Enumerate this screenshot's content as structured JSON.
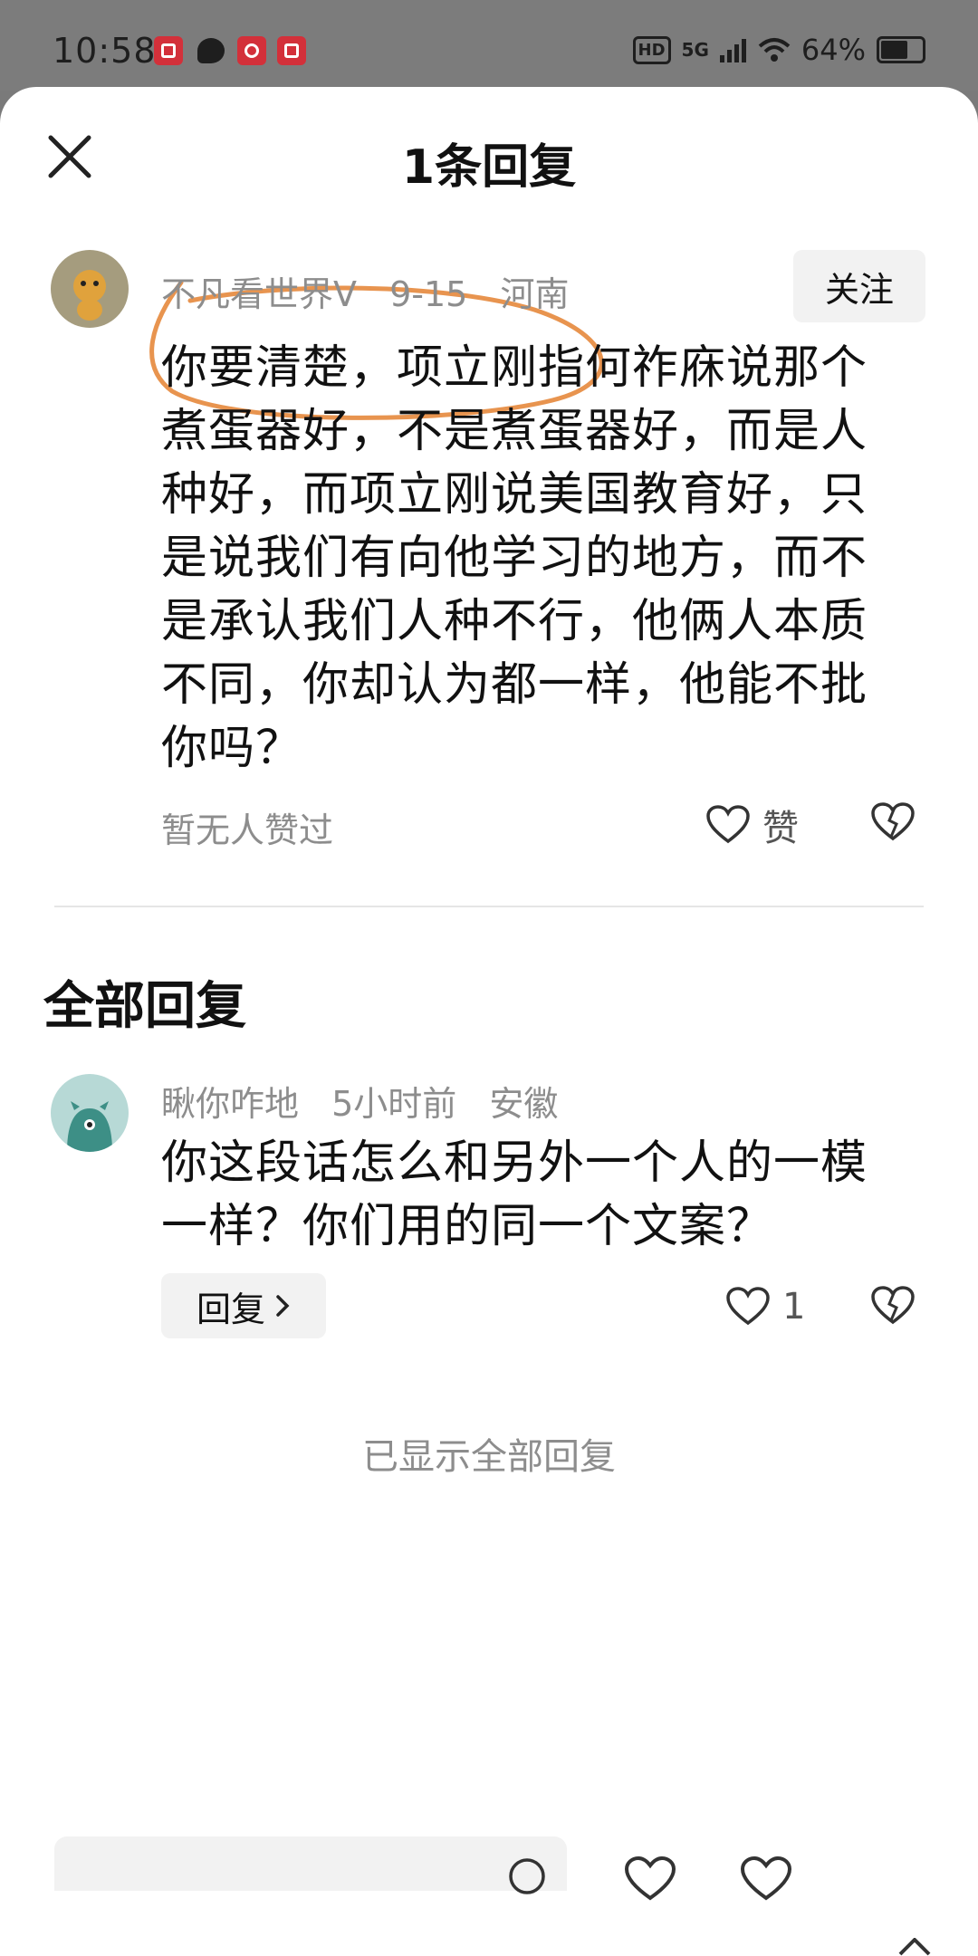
{
  "status_bar": {
    "time": "10:58",
    "network": "5G",
    "hd": "HD",
    "battery": "64%"
  },
  "header": {
    "title": "1条回复"
  },
  "main_comment": {
    "username": "不凡看世界V",
    "date": "9-15",
    "location": "河南",
    "follow_label": "关注",
    "lines": [
      "你要清楚，项立刚指何祚庥说那个",
      "煮蛋器好，不是煮蛋器好，而是人",
      "种好，而项立刚说美国教育好，只",
      "是说我们有向他学习的地方，而不",
      "是承认我们人种不行，他俩人本质",
      "不同，你却认为都一样，他能不批",
      "你吗？"
    ],
    "no_likes": "暂无人赞过",
    "like_label": "赞"
  },
  "replies_section": {
    "title": "全部回复"
  },
  "reply": {
    "username": "瞅你咋地",
    "time": "5小时前",
    "location": "安徽",
    "lines": [
      "你这段话怎么和另外一个人的一模",
      "一样？你们用的同一个文案？"
    ],
    "reply_button": "回复",
    "like_count": "1"
  },
  "footer": {
    "all_shown": "已显示全部回复"
  },
  "colors": {
    "annotation": "#e8944f",
    "muted_text": "#8d8d8d",
    "button_bg": "#f2f2f2"
  }
}
